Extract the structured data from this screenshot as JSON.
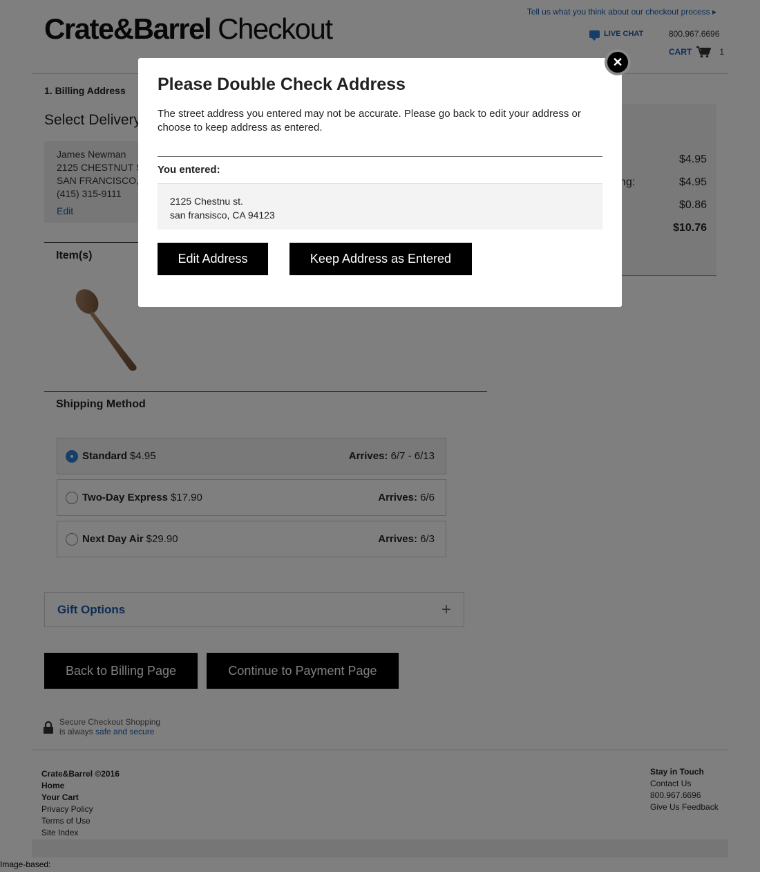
{
  "header": {
    "logo_brand": "Crate&Barrel",
    "logo_suffix": "Checkout",
    "feedback_link": "Tell us what you think about our checkout process ▸",
    "live_chat": "LIVE CHAT",
    "phone": "800.967.6696",
    "cart_label": "CART",
    "cart_count": "1"
  },
  "checkout": {
    "step_label": "1. Billing Address",
    "select_delivery": "Select Delivery",
    "address": {
      "name": "James Newman",
      "street": "2125 CHESTNUT S",
      "city": "SAN FRANCISCO,",
      "phone": "(415) 315-9111",
      "edit_label": "Edit"
    },
    "items_heading": "Item(s)",
    "shipping_heading": "Shipping Method",
    "shipping_options": [
      {
        "name": "Standard",
        "price": "$4.95",
        "arrives_label": "Arrives:",
        "arrives": "6/7 - 6/13",
        "selected": true
      },
      {
        "name": "Two-Day Express",
        "price": "$17.90",
        "arrives_label": "Arrives:",
        "arrives": "6/6",
        "selected": false
      },
      {
        "name": "Next Day Air",
        "price": "$29.90",
        "arrives_label": "Arrives:",
        "arrives": "6/3",
        "selected": false
      }
    ],
    "gift_options": "Gift Options",
    "back_button": "Back to Billing Page",
    "continue_button": "Continue to Payment Page",
    "secure_line1": "Secure Checkout Shopping",
    "secure_line2_prefix": "is always ",
    "secure_link": "safe and secure"
  },
  "summary": {
    "subtotal": "$4.95",
    "shipping_label_fragment": "ling:",
    "shipping": "$4.95",
    "tax": "$0.86",
    "total": "$10.76"
  },
  "footer": {
    "copyright": "Crate&Barrel ©2016",
    "home": "Home",
    "your_cart": "Your Cart",
    "privacy": "Privacy Policy",
    "terms": "Terms of Use",
    "site_index": "Site Index",
    "stay_in_touch": "Stay in Touch",
    "contact_us": "Contact Us",
    "phone": "800.967.6696",
    "give_feedback": "Give Us Feedback"
  },
  "image_based": "Image-based:",
  "modal": {
    "title": "Please Double Check Address",
    "message": "The street address you entered may not be accurate. Please go back to edit your address or choose to keep address as entered.",
    "entered_label": "You entered:",
    "entered_line1": "2125 Chestnu st.",
    "entered_line2": "san fransisco, CA 94123",
    "edit_button": "Edit Address",
    "keep_button": "Keep Address as Entered",
    "close_symbol": "✕"
  }
}
